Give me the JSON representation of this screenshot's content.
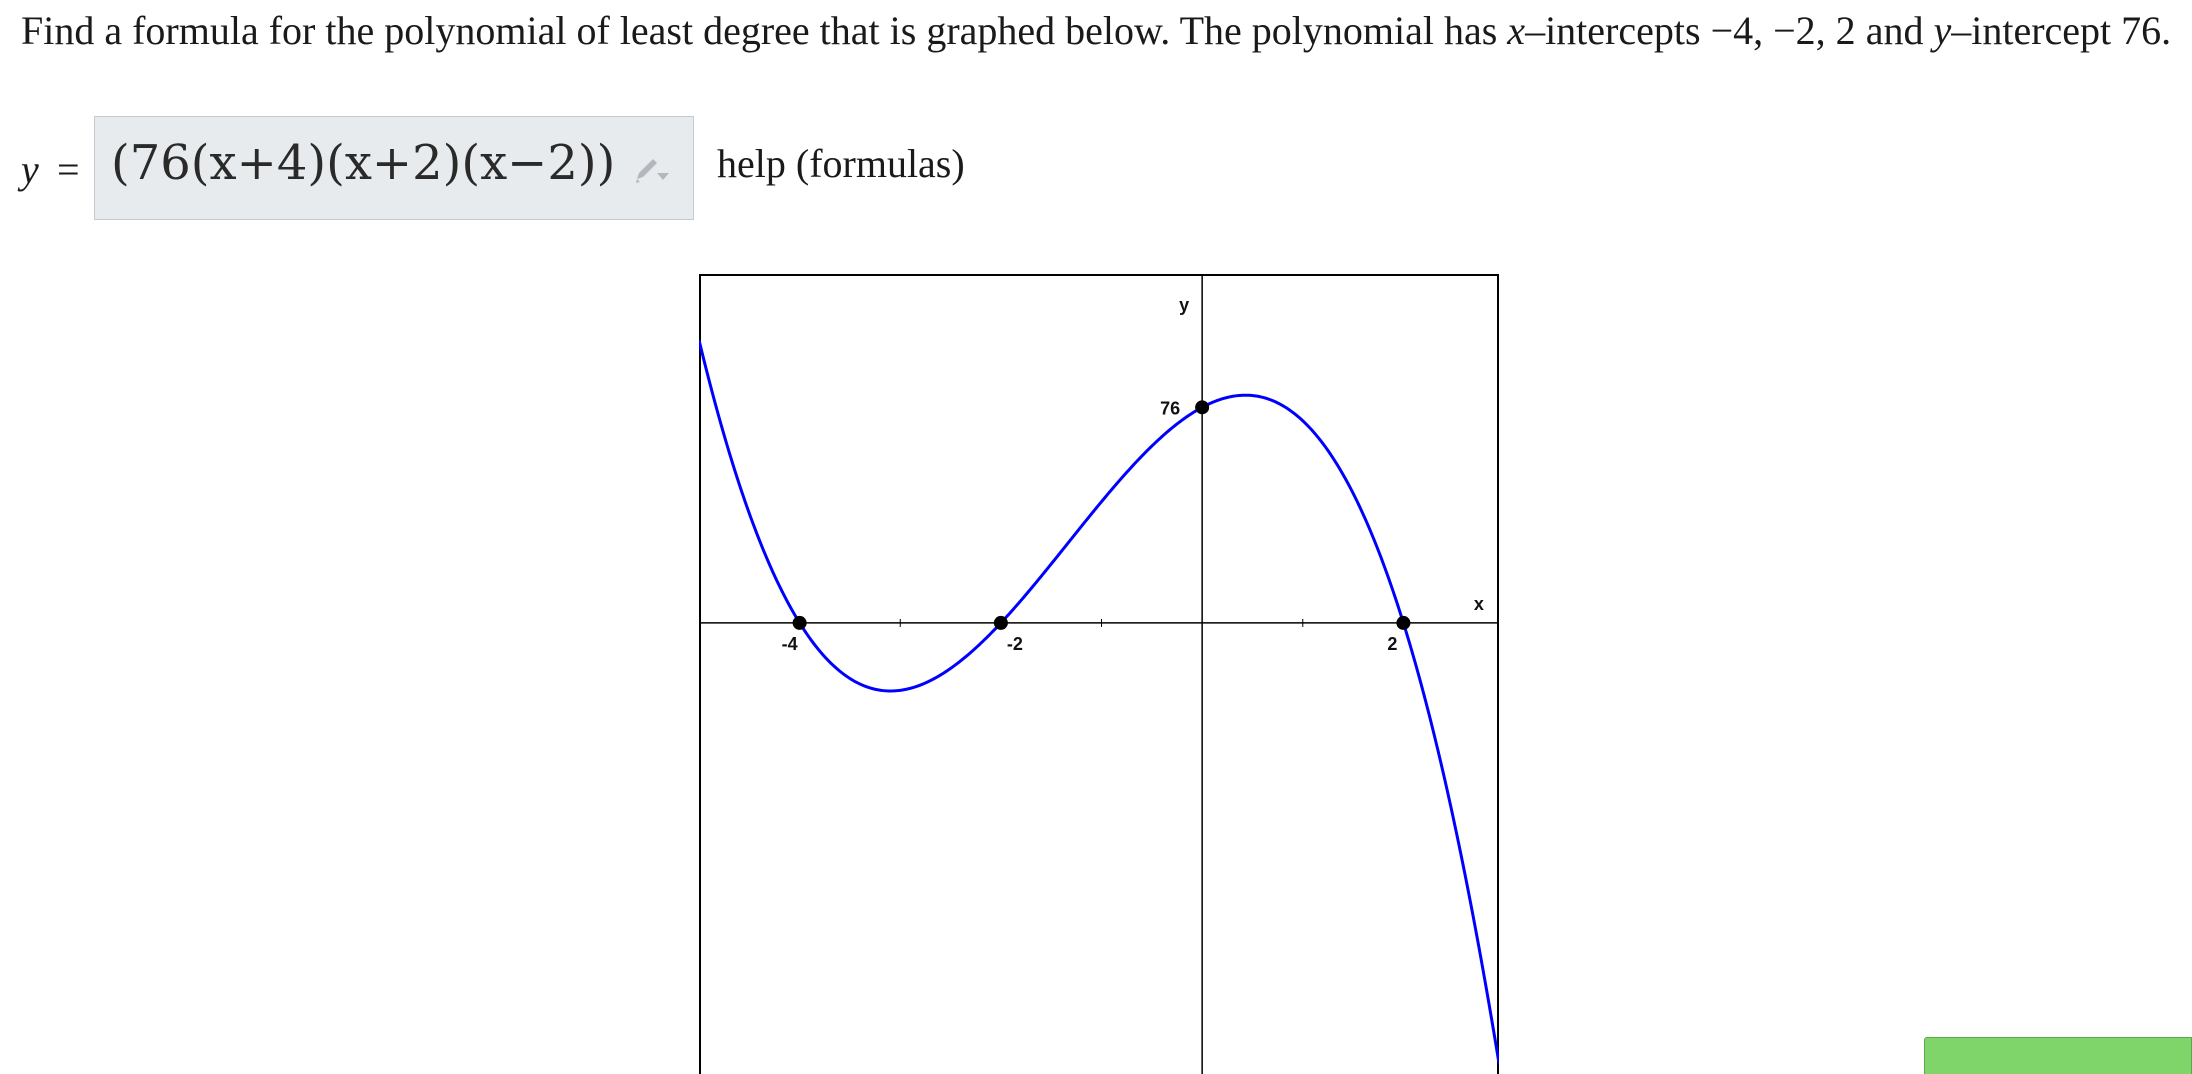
{
  "question": {
    "text_1": "Find a formula for the polynomial of least degree that is graphed below. The polynomial has ",
    "var_x": "x",
    "text_2": "–intercepts ",
    "x_intercepts_text": "−4, −2, 2",
    "text_3": " and ",
    "var_y": "y",
    "text_4": "–intercept ",
    "y_intercept_text": "76."
  },
  "answer": {
    "label": "y",
    "equals": "=",
    "value": "(76(x+4)(x+2)(x−2))",
    "edit_icon": "pencil-edit-icon"
  },
  "help": {
    "label": "help (formulas)"
  },
  "graph": {
    "x_axis_label": "x",
    "y_axis_label": "y",
    "tick_labels": {
      "neg4": "-4",
      "neg2": "-2",
      "pos2": "2",
      "y76": "76"
    },
    "curve_color": "#0000ff",
    "point_color": "#000000"
  },
  "chart_data": {
    "type": "line",
    "title": "",
    "xlabel": "x",
    "ylabel": "y",
    "xlim": [
      -5,
      2.95
    ],
    "ylim": [
      -159,
      123
    ],
    "grid": false,
    "points": [
      {
        "x": -4,
        "y": 0
      },
      {
        "x": -2,
        "y": 0
      },
      {
        "x": 0,
        "y": 76
      },
      {
        "x": 2,
        "y": 0
      }
    ],
    "series": [
      {
        "function": "-4.75*(x+4)*(x+2)*(x-2)",
        "x_range": [
          -5,
          2.95
        ]
      }
    ]
  },
  "colors": {
    "answer_box_bg": "#e8ebed",
    "submit_button": "#7fd46a"
  }
}
